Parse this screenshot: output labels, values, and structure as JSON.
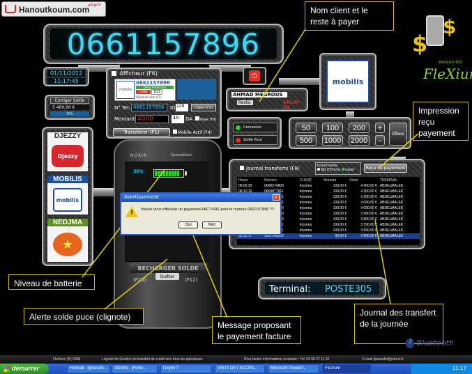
{
  "brand": {
    "logo_text": "Hanoutkoum.com",
    "logo_arabic": "حانوتكم"
  },
  "main_display": {
    "number": "0661157896"
  },
  "datetime": {
    "date": "01/11/2012",
    "time": "11:17:45"
  },
  "solde": {
    "title": "Corriger Solde",
    "value": "5 400,00 €",
    "percent": "0%"
  },
  "operators": [
    {
      "name": "DJEZZY",
      "logo": "Djezzy"
    },
    {
      "name": "MOBILIS",
      "logo": "mobilis"
    },
    {
      "name": "NEDJMA",
      "logo": ""
    }
  ],
  "afficheur": {
    "title": "Afficheur (F6)",
    "number": "0661157896",
    "status": "Demi Filtre(Gen)",
    "code_label": "Code",
    "code_value": "633",
    "reponse": "Réponse auto (F5)",
    "tel_label": "N° Tel:",
    "tel_value": "0661157896",
    "id_label": "ID",
    "id_value": "229",
    "client_btn": "Client (F2)",
    "montant_label": "Montant:",
    "montant_value": "4000",
    "qty_value": "10",
    "da_label": "DA",
    "paye_label": "Payé (F9)",
    "transferer_btn": "Transferer (F1)",
    "mobile_actif": "Mobile Actif (F4)"
  },
  "phone": {
    "brand": "NOKIA",
    "model": "XpressMusic",
    "battery_percent": "86%",
    "battery_level": 0.86,
    "recharger": "RECHARGER SOLDE",
    "f10": "(F10)",
    "quitter": "Quitter",
    "f12": "(F12)"
  },
  "client": {
    "name": "AHMAD MEGROUS",
    "reste_label": "Reste:",
    "reste_value": "540,00 DA"
  },
  "connection": {
    "connexion": "Connexion",
    "solde_puce": "Solde Puce"
  },
  "amounts": {
    "row1": [
      "50",
      "100",
      "200"
    ],
    "row2": [
      "500",
      "1000",
      "2000"
    ],
    "plus": "+",
    "minus": "-",
    "efface": "Efface"
  },
  "right_logo": {
    "brand": "FleXium",
    "subtitle": "Version Std"
  },
  "journal": {
    "title": "Journal transferts (F8)",
    "imprimante_label": "Imprimante",
    "opt1": "Bd d'Etvrie",
    "opt2": "Laser",
    "recu_btn": "Reçu du payement",
    "columns": [
      "Heure",
      "Numero",
      "CLIENT",
      "Montant",
      "Solde",
      "TERMINAL"
    ],
    "rows": [
      [
        "08:05:29",
        "0696274809",
        "Inconnu",
        "100,00 €",
        "4 400,00 €",
        "ABDELMALEK"
      ],
      [
        "08:10:10",
        "0669877811",
        "Inconnu",
        "100,00 €",
        "4 300,00 €",
        "ABDELMALEK"
      ],
      [
        "08:10:14",
        "0665419371",
        "Inconnu",
        "100,00 €",
        "4 200,00 €",
        "ABDELMALEK"
      ],
      [
        "08:12:09",
        "0665419371",
        "Inconnu",
        "100,00 €",
        "4 090,00 €",
        "ABDELMALEK"
      ],
      [
        "08:15:20",
        "0661543100",
        "Inconnu",
        "100,00 €",
        "4 090,00 €",
        "ABDELMALEK"
      ],
      [
        "08:15:20",
        "0661543100",
        "Inconnu",
        "100,00 €",
        "3 990,00 €",
        "ABDELMALEK"
      ],
      [
        "08:19:11",
        "0669812273",
        "Inconnu",
        "100,00 €",
        "3 890,00 €",
        "ABDELMALEK"
      ],
      [
        "08:27:09",
        "0778430021",
        "Inconnu",
        "100,00 €",
        "3 790,00 €",
        "ABDELMALEK"
      ],
      [
        "08:31:52",
        "0661115796",
        "Inconnu",
        "100,00 €",
        "3 690,00 €",
        "ABDELMALEK"
      ],
      [
        "08:52:17",
        "0697548002",
        "Inconnu",
        "90,00 €",
        "3 600,00 €",
        "ABDELMALEK"
      ]
    ]
  },
  "terminal": {
    "label": "Terminal:",
    "value": "POSTE305"
  },
  "dialog": {
    "title": "Avertissement",
    "message": "Voulez vous effectuer un payement FACTURE pour le numero 0661157896 ??",
    "yes": "Oui",
    "no": "Non",
    "close": "✕"
  },
  "annotations": {
    "nom_client": "Nom client et le reste à payer",
    "impression": "Impression reçu payement",
    "batterie": "Niveau de batterie",
    "alerte": "Alerte solde puce (clignote)",
    "message": "Message proposant le payement facture",
    "journal": "Journal des transfert de la journée"
  },
  "footer": {
    "copyright": "FleXium (R) 2008",
    "logiciel": "Logiciel de Gestion du transfert de crédit vers tous les opérateurs",
    "contact": "Pour toutes informations contacter :   Tel: 03 60 27 11 62",
    "email": "E-mail djnaoufel@yahoo.fr",
    "bluetooth": "Bluetooth"
  },
  "taskbar": {
    "start": "démarrer",
    "items": [
      "Hotmail - djnaoufe...",
      "ADMIN - [Fiche...",
      "Delphi 7",
      "VISTA DET ACCES...",
      "Microsoft PowerP...",
      "FleXium"
    ],
    "clock": "11:17"
  },
  "colors": {
    "digit_cyan": "#44d9f2",
    "annot_border": "#d8c200",
    "annot_line": "#e2d200",
    "taskbar_blue": "#2459c8",
    "start_green": "#3a9b2e"
  }
}
